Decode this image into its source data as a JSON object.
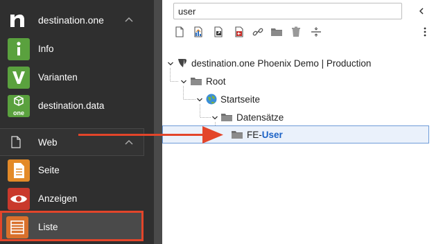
{
  "sidebar": {
    "app_title": "destination.one",
    "modules": [
      {
        "label": "Info",
        "icon": "info-icon",
        "color": "#5a9a3a"
      },
      {
        "label": "Varianten",
        "icon": "varianten-icon",
        "color": "#5a9a3a"
      },
      {
        "label": "destination.data",
        "icon": "destination-data-icon",
        "color": "#5a9a3a",
        "badge": "one"
      }
    ],
    "web_group": {
      "label": "Web"
    },
    "web_modules": [
      {
        "label": "Seite",
        "icon": "page-icon",
        "color": "#e38a28"
      },
      {
        "label": "Anzeigen",
        "icon": "eye-icon",
        "color": "#d33a2c"
      },
      {
        "label": "Liste",
        "icon": "list-icon",
        "color": "#e3742a"
      }
    ]
  },
  "tree": {
    "search": {
      "value": "user"
    },
    "nodes": [
      {
        "label": "destination.one Phoenix Demo | Production",
        "icon": "typo3-icon"
      },
      {
        "label": "Root",
        "icon": "folder-icon"
      },
      {
        "label": "Startseite",
        "icon": "globe-icon"
      },
      {
        "label": "Datensätze",
        "icon": "folder-icon"
      },
      {
        "label_prefix": "FE-",
        "label_match": "User",
        "icon": "folder-icon"
      }
    ]
  },
  "colors": {
    "accent_red": "#e3452a",
    "highlight_blue": "#1b62c6"
  }
}
